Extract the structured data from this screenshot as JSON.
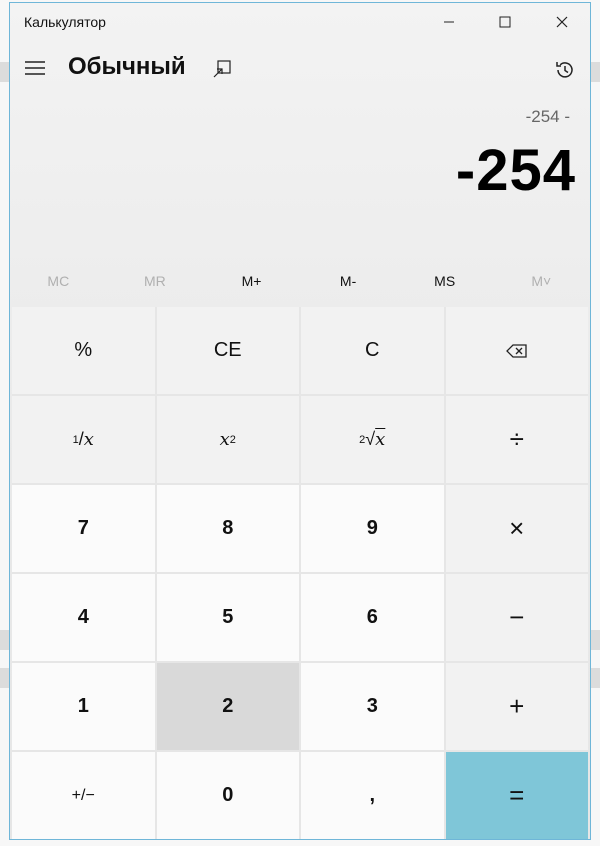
{
  "window": {
    "title": "Калькулятор"
  },
  "header": {
    "mode": "Обычный"
  },
  "display": {
    "expression": "-254 -",
    "value": "-254"
  },
  "memory": [
    {
      "label": "MC",
      "enabled": false
    },
    {
      "label": "MR",
      "enabled": false
    },
    {
      "label": "M+",
      "enabled": true
    },
    {
      "label": "M-",
      "enabled": true
    },
    {
      "label": "MS",
      "enabled": true
    },
    {
      "label": "M˅",
      "enabled": false
    }
  ],
  "keys": {
    "percent": "%",
    "clear_entry": "CE",
    "clear": "C",
    "reciprocal_num": "1",
    "reciprocal_den": "x",
    "square_base": "x",
    "square_exp": "2",
    "sqrt_index": "2",
    "sqrt_arg": "x",
    "divide": "÷",
    "d7": "7",
    "d8": "8",
    "d9": "9",
    "multiply": "×",
    "d4": "4",
    "d5": "5",
    "d6": "6",
    "subtract": "−",
    "d1": "1",
    "d2": "2",
    "d3": "3",
    "add": "+",
    "negate": "+/−",
    "d0": "0",
    "decimal": ",",
    "equals": "="
  },
  "colors": {
    "equals_key": "#7fc6d8",
    "window_border": "#6fb6d8",
    "pressed_key": "#d9d9d9"
  }
}
